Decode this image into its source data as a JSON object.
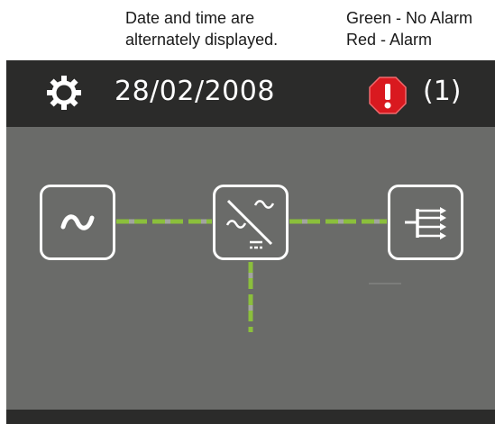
{
  "annotations": {
    "date_note_line1": "Date and time are",
    "date_note_line2": "alternately displayed.",
    "alarm_note_line1": "Green - No Alarm",
    "alarm_note_line2": "Red - Alarm"
  },
  "header": {
    "date": "28/02/2008",
    "alarm_count": "(1)",
    "settings_icon": "gear-icon",
    "alarm_icon": "alarm-octagon-icon"
  },
  "diagram": {
    "nodes": [
      {
        "id": "ac-source",
        "icon": "sine-wave-icon"
      },
      {
        "id": "converter",
        "icon": "converter-icon"
      },
      {
        "id": "load-distribution",
        "icon": "distribution-icon"
      }
    ],
    "links_status": "No Alarm"
  },
  "colors": {
    "screen_bg": "#6a6b69",
    "bar_bg": "#2b2b2a",
    "link_green": "#8bbf3c",
    "link_gray": "#a2a49f",
    "alarm_red": "#d9191f",
    "icon_white": "#ffffff"
  }
}
